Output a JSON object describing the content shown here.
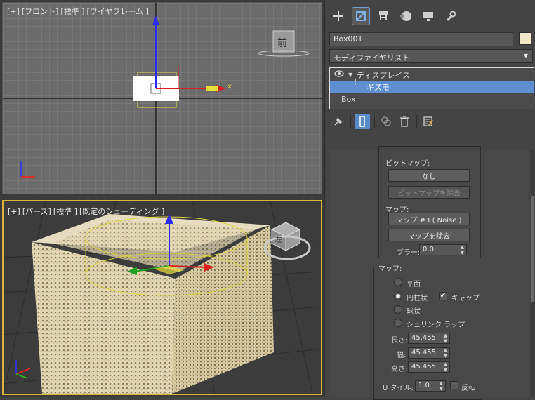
{
  "viewports": {
    "front": {
      "labels": [
        "[+]",
        "[フロント]",
        "[標準 ]",
        "[ワイヤフレーム ]"
      ],
      "viewcube_label": "前",
      "axis_x": "x"
    },
    "perspective": {
      "labels": [
        "[+]",
        "[パース]",
        "[標準 ]",
        "[既定のシェーディング ]"
      ],
      "viewcube_label": "左"
    }
  },
  "panel": {
    "tabs": [
      "create-icon",
      "modify-icon",
      "hierarchy-icon",
      "motion-icon",
      "display-icon",
      "utilities-icon"
    ],
    "object_name": "Box001",
    "object_color": "#f0e8c8",
    "modifier_list": "モディファイヤリスト",
    "stack": {
      "displace": "ディスプレイス",
      "gizmo": "ギズモ",
      "box": "Box"
    },
    "bitmap": {
      "label": "ビットマップ:",
      "none_button": "なし",
      "remove_button": "ビットマップを除去"
    },
    "map": {
      "label": "マップ:",
      "map_button": "マップ #3 ( Noise )",
      "remove_button": "マップを除去",
      "blur_label": "ブラー:",
      "blur_value": "0.0"
    },
    "mapping": {
      "title": "マップ:",
      "planar": "平面",
      "cylindrical": "円柱状",
      "cap": "キャップ",
      "spherical": "球状",
      "shrinkwrap": "シュリンク ラップ",
      "length_label": "長さ:",
      "length_value": "45.455",
      "width_label": "幅:",
      "width_value": "45.455",
      "height_label": "高さ:",
      "height_value": "45.455",
      "utile_label": "U タイル:",
      "utile_value": "1.0",
      "flip_label": "反転"
    }
  }
}
